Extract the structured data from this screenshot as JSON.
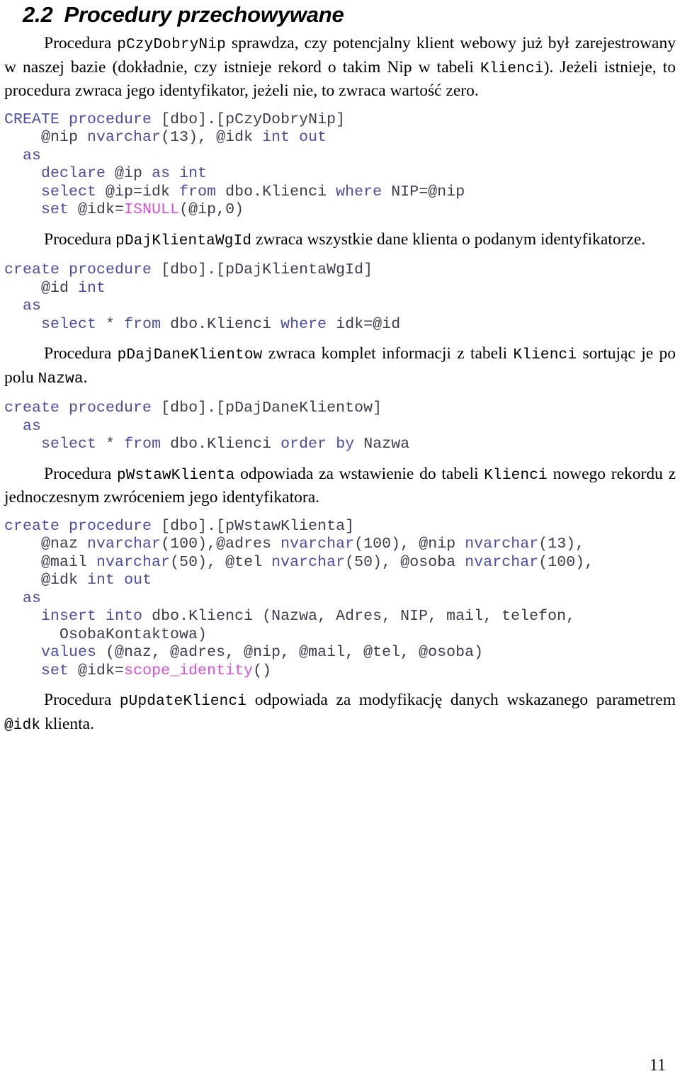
{
  "document": {
    "heading": {
      "number": "2.2",
      "title": "Procedury przechowywane"
    },
    "page_number": "11",
    "paragraphs": {
      "p1_a": "Procedura ",
      "p1_code1": "pCzyDobryNip",
      "p1_b": " sprawdza, czy potencjalny klient webowy już był zarejestrowany w naszej bazie (dokładnie, czy istnieje rekord o takim Nip w tabeli ",
      "p1_code2": "Klienci",
      "p1_c": "). Jeżeli istnieje, to procedura zwraca jego identyfikator, jeżeli nie, to zwraca wartość zero.",
      "p2_a": "Procedura ",
      "p2_code1": "pDajKlientaWgId",
      "p2_b": " zwraca wszystkie dane klienta o podanym identyfikatorze.",
      "p3_a": "Procedura ",
      "p3_code1": "pDajDaneKlientow",
      "p3_b": " zwraca komplet informacji z tabeli ",
      "p3_code2": "Klienci",
      "p3_c": " sortując je po polu ",
      "p3_code3": "Nazwa",
      "p3_d": ".",
      "p4_a": "Procedura ",
      "p4_code1": "pWstawKlienta",
      "p4_b": " odpowiada za wstawienie do tabeli ",
      "p4_code2": "Klienci",
      "p4_c": " nowego rekordu z jednoczesnym zwróceniem jego identyfikatora.",
      "p5_a": "Procedura ",
      "p5_code1": "pUpdateKlienci",
      "p5_b": " odpowiada za modyfikację danych wskazanego parametrem ",
      "p5_code2": "@idk",
      "p5_c": " klienta."
    },
    "code_blocks": {
      "block1_name": "pCzyDobryNip",
      "block1_lines": [
        "CREATE procedure [dbo].[pCzyDobryNip]",
        "    @nip nvarchar(13), @idk int out",
        "  as",
        "    declare @ip as int",
        "    select @ip=idk from dbo.Klienci where NIP=@nip",
        "    set @idk=ISNULL(@ip,0)"
      ],
      "block2_name": "pDajKlientaWgId",
      "block2_lines": [
        "create procedure [dbo].[pDajKlientaWgId]",
        "    @id int",
        "  as",
        "    select * from dbo.Klienci where idk=@id"
      ],
      "block3_name": "pDajDaneKlientow",
      "block3_lines": [
        "create procedure [dbo].[pDajDaneKlientow]",
        "  as",
        "    select * from dbo.Klienci order by Nazwa"
      ],
      "block4_name": "pWstawKlienta",
      "block4_lines": [
        "create procedure [dbo].[pWstawKlienta]",
        "    @naz nvarchar(100),@adres nvarchar(100), @nip nvarchar(13),",
        "    @mail nvarchar(50), @tel nvarchar(50), @osoba nvarchar(100),",
        "    @idk int out",
        "  as",
        "    insert into dbo.Klienci (Nazwa, Adres, NIP, mail, telefon,",
        "      OsobaKontaktowa)",
        "    values (@naz, @adres, @nip, @mail, @tel, @osoba)",
        "    set @idk=scope_identity()"
      ]
    },
    "colors": {
      "keyword": "#4b4ba8",
      "function": "#d94fd9",
      "plain": "#3b3b4f",
      "text": "#000000"
    }
  }
}
